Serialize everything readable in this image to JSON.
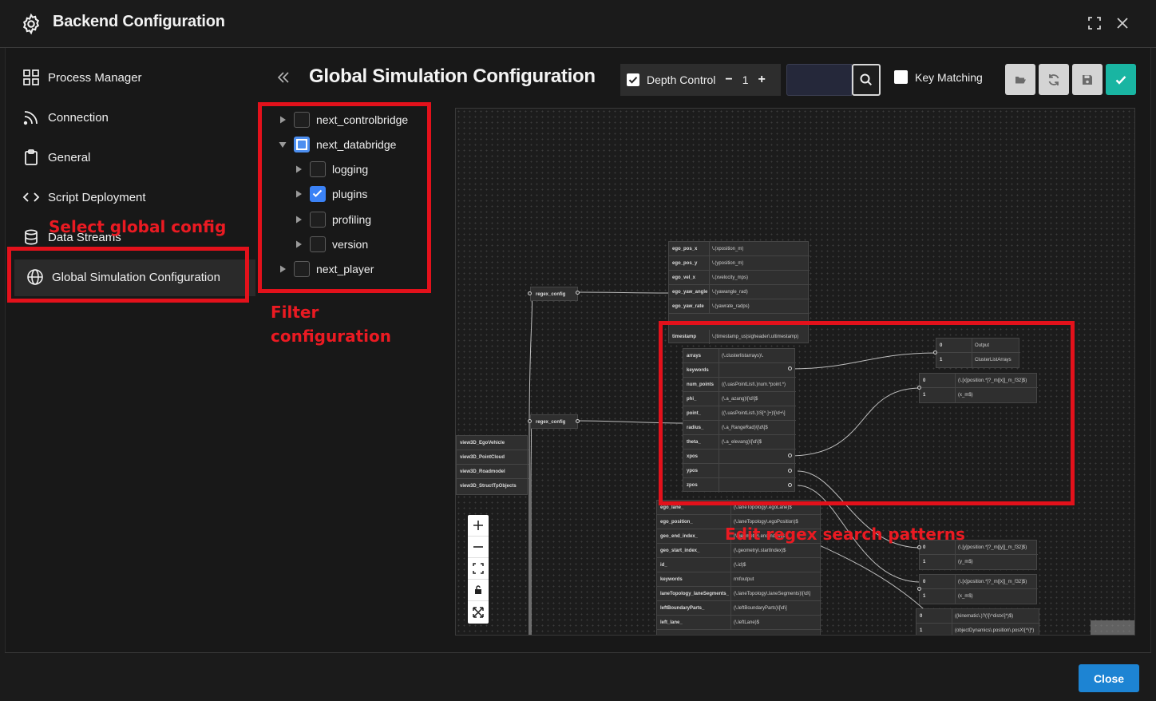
{
  "header": {
    "title": "Backend Configuration"
  },
  "sidebar": {
    "items": [
      {
        "label": "Process Manager"
      },
      {
        "label": "Connection"
      },
      {
        "label": "General"
      },
      {
        "label": "Script Deployment"
      },
      {
        "label": "Data Streams"
      },
      {
        "label": "Global Simulation Configuration"
      }
    ]
  },
  "main": {
    "title": "Global Simulation Configuration",
    "toolbar": {
      "depth_label": "Depth Control",
      "depth_value": "1",
      "search_value": "",
      "key_matching_label": "Key Matching"
    },
    "tree": [
      {
        "label": "next_controlbridge"
      },
      {
        "label": "next_databridge"
      },
      {
        "label": "logging"
      },
      {
        "label": "plugins"
      },
      {
        "label": "profiling"
      },
      {
        "label": "version"
      },
      {
        "label": "next_player"
      }
    ]
  },
  "annotations": {
    "select_global": "Select global config",
    "filter_1": "Filter",
    "filter_2": "configuration",
    "edit_regex": "Edit regex search patterns"
  },
  "graph": {
    "regex1": "regex_config",
    "regex2": "regex_config",
    "left_nodes": [
      "view3D_EgoVehicle",
      "view3D_PointCloud",
      "view3D_Roadmodel",
      "view3D_StructTpObjects"
    ],
    "ego": [
      {
        "k": "ego_pos_x",
        "v": "\\.(xposition_m)"
      },
      {
        "k": "ego_pos_y",
        "v": "\\.(yposition_m)"
      },
      {
        "k": "ego_vel_x",
        "v": "\\.(xvelocity_mps)"
      },
      {
        "k": "ego_yaw_angle",
        "v": "\\.(yawangle_rad)"
      },
      {
        "k": "ego_yaw_rate",
        "v": "\\.(yawrate_radps)"
      },
      {
        "k": "timestamp",
        "v": "\\.(timestamp_us|sigheader\\.ultimestamp)"
      }
    ],
    "cluster": [
      {
        "k": "arrays",
        "v": "(\\.clusterlistarrays)\\."
      },
      {
        "k": "keywords",
        "v": ""
      },
      {
        "k": "num_points",
        "v": "((\\.uasPointList\\.)num.*point.*)"
      },
      {
        "k": "phi_",
        "v": "(\\.a_azang)\\[\\d\\]$"
      },
      {
        "k": "point_",
        "v": "((\\.uasPointList\\.)\\S[^.]+)\\[\\d+\\]"
      },
      {
        "k": "radius_",
        "v": "(\\.a_RangeRad)\\[\\d\\]$"
      },
      {
        "k": "theta_",
        "v": "(\\.a_elevang)\\[\\d\\]$"
      },
      {
        "k": "xpos",
        "v": ""
      },
      {
        "k": "ypos",
        "v": ""
      },
      {
        "k": "zpos",
        "v": ""
      }
    ],
    "output_node": [
      {
        "k": "0",
        "v": "Output"
      },
      {
        "k": "1",
        "v": "ClusterListArrays"
      }
    ],
    "x_node": [
      {
        "k": "0",
        "v": "(\\.[x]position.*[?_m|[x]]_m_f32]$)"
      },
      {
        "k": "1",
        "v": "(x_m$)"
      }
    ],
    "y_node": [
      {
        "k": "0",
        "v": "(\\.[y]position.*[?_m|[y]]_m_f32]$)"
      },
      {
        "k": "1",
        "v": "(y_m$)"
      }
    ],
    "x2_node": [
      {
        "k": "0",
        "v": "(\\.[x]position.*[?_m|[x]]_m_f32]$)"
      },
      {
        "k": "1",
        "v": "(x_m$)"
      }
    ],
    "kin_node": [
      {
        "k": "0",
        "v": "((kinematic\\.)?(\\[\\^distx\\]*)$)"
      },
      {
        "k": "1",
        "v": "(objectDynamics\\.position\\.posX\\[^\\]*)"
      }
    ],
    "lane": [
      {
        "k": "ego_lane_",
        "v": "(\\.laneTopology\\.egoLane)$"
      },
      {
        "k": "ego_position_",
        "v": "(\\.laneTopology\\.egoPosition)$"
      },
      {
        "k": "geo_end_index_",
        "v": "(\\.geometry\\.endIndex)$"
      },
      {
        "k": "geo_start_index_",
        "v": "(\\.geometry\\.startIndex)$"
      },
      {
        "k": "id_",
        "v": "(\\.id)$"
      },
      {
        "k": "keywords",
        "v": "rmfoutput"
      },
      {
        "k": "laneTopology_laneSegments_",
        "v": "(\\.laneTopology\\.laneSegments)\\[\\d\\]"
      },
      {
        "k": "leftBoundaryParts_",
        "v": "(\\.leftBoundaryParts)\\[\\d\\]"
      },
      {
        "k": "left_lane_",
        "v": "(\\.leftLane)$"
      }
    ]
  },
  "footer": {
    "close_label": "Close"
  }
}
